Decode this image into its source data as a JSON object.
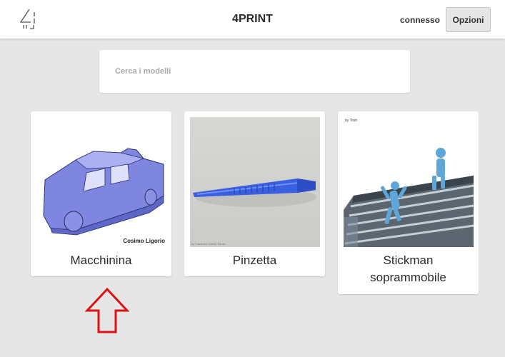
{
  "header": {
    "title": "4PRINT",
    "status": "connesso",
    "options_label": "Opzioni"
  },
  "search": {
    "placeholder": "Cerca i modelli"
  },
  "models": [
    {
      "name": "Macchinina",
      "credit": "Cosimo Ligorio",
      "icon": "toy-car-3d-model"
    },
    {
      "name": "Pinzetta",
      "credit": "by Fraderico Onerld Santa",
      "icon": "tweezers-3d-model"
    },
    {
      "name": "Stickman soprammobile",
      "credit": "by Tosh",
      "icon": "stickman-figures-photo"
    }
  ],
  "colors": {
    "background": "#e6e6e6",
    "card": "#ffffff",
    "model_blue": "#7f86e0",
    "arrow": "#dd1111"
  }
}
